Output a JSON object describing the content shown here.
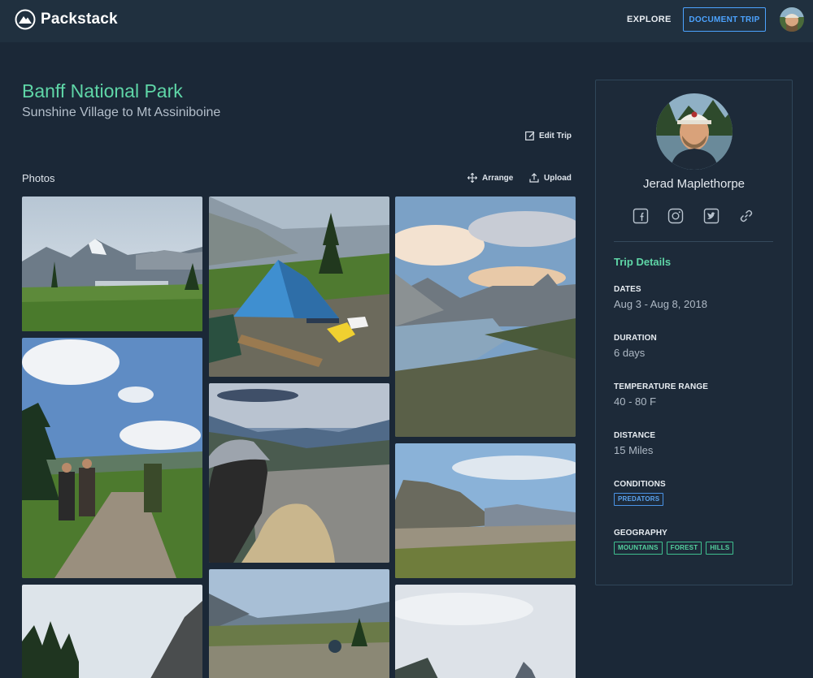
{
  "nav": {
    "brand": "Packstack",
    "explore": "EXPLORE",
    "document_trip": "DOCUMENT TRIP"
  },
  "trip": {
    "title": "Banff National Park",
    "subtitle": "Sunshine Village to Mt Assiniboine",
    "edit": "Edit Trip"
  },
  "photos": {
    "label": "Photos",
    "arrange": "Arrange",
    "upload": "Upload"
  },
  "profile": {
    "name": "Jerad Maplethorpe",
    "socials": [
      "facebook-icon",
      "instagram-icon",
      "twitter-icon",
      "link-icon"
    ]
  },
  "trip_details": {
    "title": "Trip Details",
    "dates_label": "DATES",
    "dates": "Aug 3 - Aug 8, 2018",
    "duration_label": "DURATION",
    "duration": "6 days",
    "temp_label": "TEMPERATURE RANGE",
    "temp": "40 - 80 F",
    "distance_label": "DISTANCE",
    "distance": "15 Miles",
    "conditions_label": "CONDITIONS",
    "conditions": [
      "PREDATORS"
    ],
    "geography_label": "GEOGRAPHY",
    "geography": [
      "MOUNTAINS",
      "FOREST",
      "HILLS"
    ]
  },
  "colors": {
    "background": "#1b2837",
    "nav": "#20303f",
    "accent_green": "#5fd6a7",
    "accent_blue": "#4ca3ff"
  }
}
